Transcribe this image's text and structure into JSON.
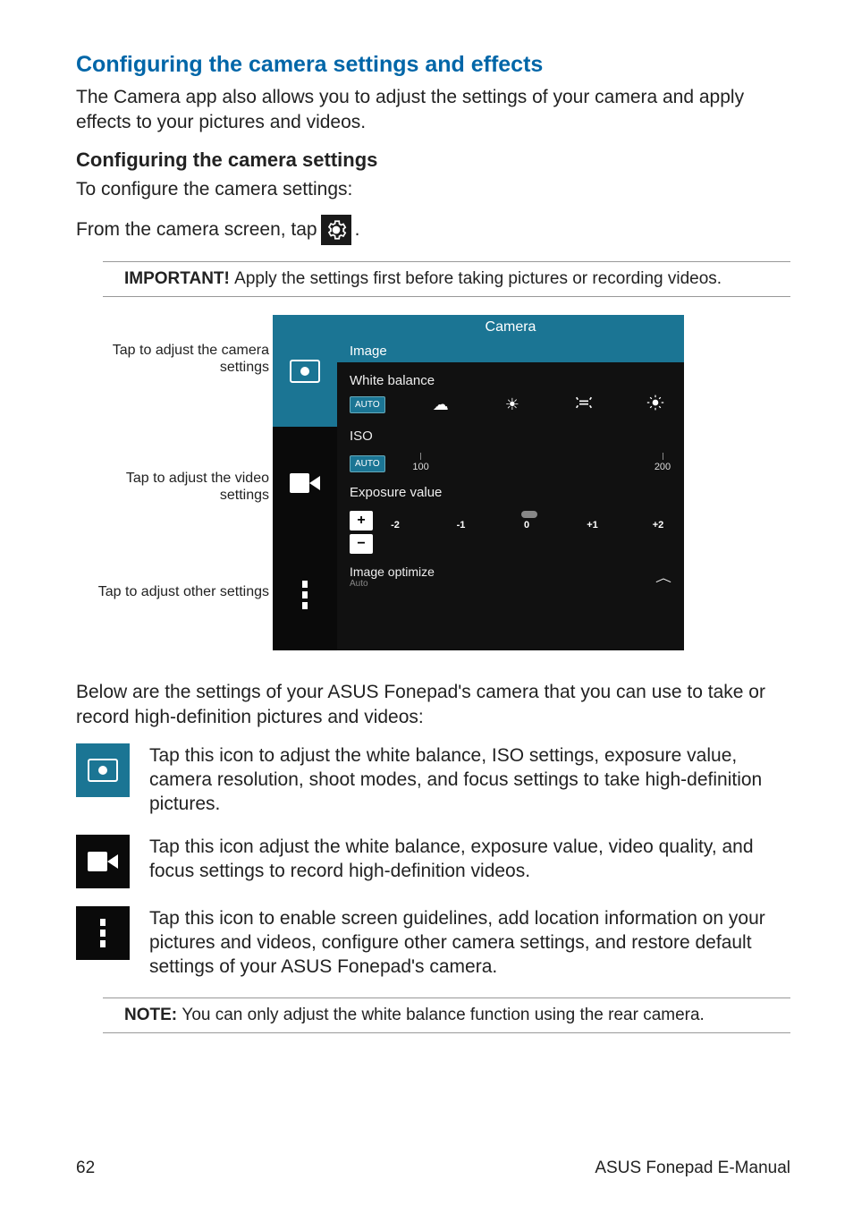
{
  "heading": "Configuring the camera settings and effects",
  "intro": "The Camera app also allows you to adjust the settings of your camera and apply effects to your pictures and videos.",
  "subheading": "Configuring the camera settings",
  "sub_intro": "To configure the camera settings:",
  "instr_prefix": "From the camera screen, tap ",
  "instr_suffix": ".",
  "important_label": "IMPORTANT!  ",
  "important_text": "Apply the settings first before taking pictures or recording videos.",
  "annotations": {
    "camera": "Tap to adjust the camera settings",
    "video": "Tap to adjust the video settings",
    "other": "Tap to adjust other settings"
  },
  "screenshot": {
    "title": "Camera",
    "section_image": "Image",
    "white_balance_label": "White balance",
    "auto_badge": "AUTO",
    "iso_label": "ISO",
    "iso_min": "100",
    "iso_max": "200",
    "exposure_label": "Exposure value",
    "ev_values": [
      "-2",
      "-1",
      "0",
      "+1",
      "+2"
    ],
    "optimize_label": "Image optimize",
    "optimize_sub": "Auto"
  },
  "below_text": "Below are the settings of your ASUS Fonepad's camera that you can use to take or record high-definition pictures and videos:",
  "icons": {
    "camera_desc": "Tap this icon to adjust the white balance, ISO settings, exposure value, camera resolution, shoot modes, and focus settings to take high-definition pictures.",
    "video_desc": "Tap this icon adjust the white balance, exposure value, video quality, and focus settings to record high-definition videos.",
    "other_desc": "Tap this icon to enable screen guidelines, add location information on your pictures and videos, configure other camera settings, and restore default settings of your ASUS Fonepad's camera."
  },
  "note_label": "NOTE:  ",
  "note_text": "You can only adjust the white balance function using the rear camera.",
  "page_number": "62",
  "footer_text": "ASUS Fonepad E-Manual"
}
